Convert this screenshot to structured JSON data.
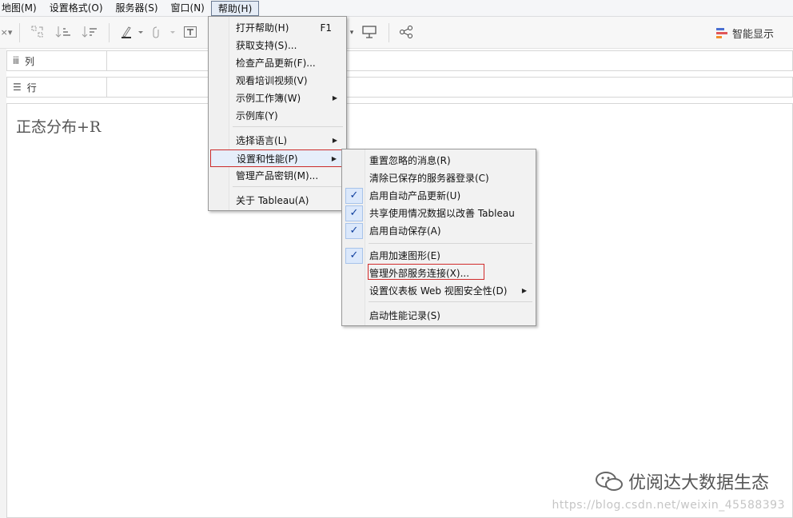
{
  "menubar": {
    "items": [
      {
        "label": "地图(M)",
        "active": false
      },
      {
        "label": "设置格式(O)",
        "active": false
      },
      {
        "label": "服务器(S)",
        "active": false
      },
      {
        "label": "窗口(N)",
        "active": false
      },
      {
        "label": "帮助(H)",
        "active": true
      }
    ]
  },
  "toolbar": {
    "smart_show_label": "智能显示",
    "smart_colors": [
      "#4a6fd1",
      "#e15759",
      "#f28e2b"
    ]
  },
  "shelves": {
    "columns_label": "列",
    "rows_label": "行"
  },
  "sheet": {
    "title": "正态分布+R"
  },
  "help_menu": {
    "items": [
      {
        "label": "打开帮助(H)",
        "shortcut": "F1",
        "submenu": false
      },
      {
        "label": "获取支持(S)...",
        "shortcut": "",
        "submenu": false
      },
      {
        "label": "检查产品更新(F)...",
        "shortcut": "",
        "submenu": false
      },
      {
        "label": "观看培训视频(V)",
        "shortcut": "",
        "submenu": false
      },
      {
        "label": "示例工作簿(W)",
        "shortcut": "",
        "submenu": true
      },
      {
        "label": "示例库(Y)",
        "shortcut": "",
        "submenu": false
      },
      {
        "label": "选择语言(L)",
        "shortcut": "",
        "submenu": true
      },
      {
        "label": "设置和性能(P)",
        "shortcut": "",
        "submenu": true,
        "highlighted": true
      },
      {
        "label": "管理产品密钥(M)...",
        "shortcut": "",
        "submenu": false
      },
      {
        "label": "关于 Tableau(A)",
        "shortcut": "",
        "submenu": false
      }
    ]
  },
  "settings_menu": {
    "items": [
      {
        "label": "重置忽略的消息(R)",
        "checked": false,
        "submenu": false
      },
      {
        "label": "清除已保存的服务器登录(C)",
        "checked": false,
        "submenu": false
      },
      {
        "label": "启用自动产品更新(U)",
        "checked": true,
        "submenu": false
      },
      {
        "label": "共享使用情况数据以改善 Tableau",
        "checked": true,
        "submenu": false
      },
      {
        "label": "启用自动保存(A)",
        "checked": true,
        "submenu": false
      },
      {
        "label": "启用加速图形(E)",
        "checked": true,
        "submenu": false
      },
      {
        "label": "管理外部服务连接(X)...",
        "checked": false,
        "submenu": false,
        "boxed": true
      },
      {
        "label": "设置仪表板 Web 视图安全性(D)",
        "checked": false,
        "submenu": true
      },
      {
        "label": "启动性能记录(S)",
        "checked": false,
        "submenu": false
      }
    ],
    "check_glyph": "✓"
  },
  "watermark": {
    "brand": "优阅达大数据生态",
    "url": "https://blog.csdn.net/weixin_45588393"
  }
}
